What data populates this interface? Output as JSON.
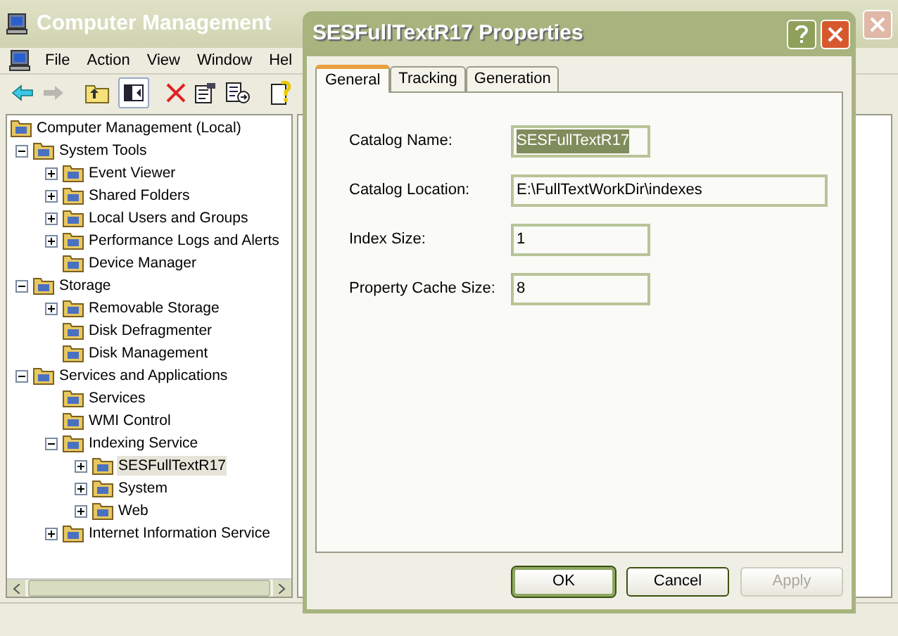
{
  "main_window": {
    "title": "Computer Management"
  },
  "menu": [
    "File",
    "Action",
    "View",
    "Window",
    "Hel"
  ],
  "tree": [
    {
      "label": "Computer Management (Local)",
      "selected": false,
      "children": [
        {
          "label": "System Tools",
          "expanded": true,
          "selected": false,
          "children": [
            {
              "label": "Event Viewer",
              "expanded": false,
              "selected": false
            },
            {
              "label": "Shared Folders",
              "expanded": false,
              "selected": false
            },
            {
              "label": "Local Users and Groups",
              "expanded": false,
              "selected": false
            },
            {
              "label": "Performance Logs and Alerts",
              "expanded": false,
              "selected": false
            },
            {
              "label": "Device Manager",
              "selected": false
            }
          ]
        },
        {
          "label": "Storage",
          "expanded": true,
          "selected": false,
          "children": [
            {
              "label": "Removable Storage",
              "expanded": false,
              "selected": false
            },
            {
              "label": "Disk Defragmenter",
              "selected": false
            },
            {
              "label": "Disk Management",
              "selected": false
            }
          ]
        },
        {
          "label": "Services and Applications",
          "expanded": true,
          "selected": false,
          "children": [
            {
              "label": "Services",
              "selected": false
            },
            {
              "label": "WMI Control",
              "selected": false
            },
            {
              "label": "Indexing Service",
              "expanded": true,
              "selected": false,
              "children": [
                {
                  "label": "SESFullTextR17",
                  "expanded": false,
                  "selected": true
                },
                {
                  "label": "System",
                  "expanded": false,
                  "selected": false
                },
                {
                  "label": "Web",
                  "expanded": false,
                  "selected": false
                }
              ]
            },
            {
              "label": "Internet Information Service",
              "expanded": false,
              "selected": false
            }
          ]
        }
      ]
    }
  ],
  "dialog": {
    "title": "SESFullTextR17 Properties",
    "tabs": [
      {
        "label": "General",
        "selected": true
      },
      {
        "label": "Tracking",
        "selected": false
      },
      {
        "label": "Generation",
        "selected": false
      }
    ],
    "fields": [
      {
        "label": "Catalog Name:",
        "value": "SESFullTextR17",
        "kind": "short",
        "text_selected": true
      },
      {
        "label": "Catalog Location:",
        "value": "E:\\FullTextWorkDir\\indexes",
        "kind": "wide",
        "text_selected": false
      },
      {
        "label": "Index Size:",
        "value": "1",
        "kind": "short",
        "text_selected": false
      },
      {
        "label": "Property Cache Size:",
        "value": "8",
        "kind": "short",
        "text_selected": false
      }
    ],
    "buttons": [
      {
        "label": "OK",
        "default": true,
        "disabled": false
      },
      {
        "label": "Cancel",
        "default": false,
        "disabled": false
      },
      {
        "label": "Apply",
        "default": false,
        "disabled": true
      }
    ]
  }
}
